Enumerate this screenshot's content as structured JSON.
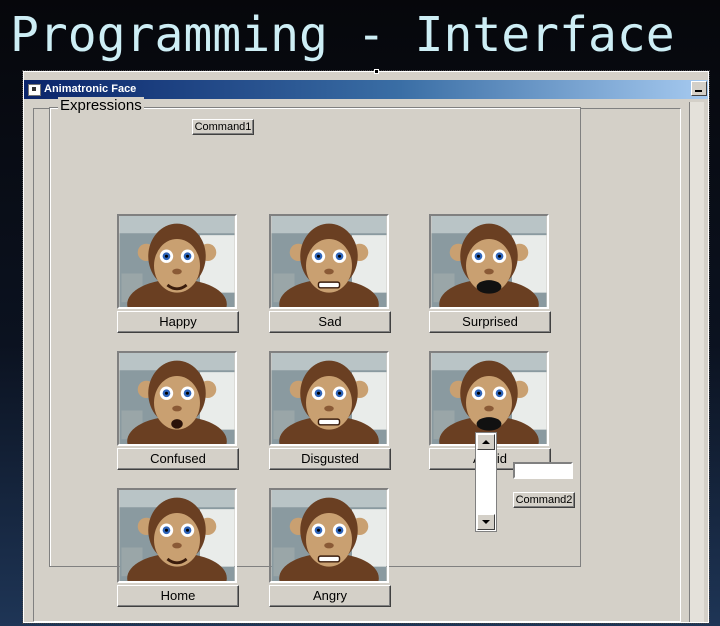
{
  "slide": {
    "title": "Programming - Interface"
  },
  "window": {
    "title": "Animatronic Face"
  },
  "frame": {
    "caption": "Expressions"
  },
  "buttons": {
    "command1": "Command1",
    "command2": "Command2"
  },
  "expressions": [
    {
      "label": "Happy",
      "mouth": "smile"
    },
    {
      "label": "Sad",
      "mouth": "teeth"
    },
    {
      "label": "Surprised",
      "mouth": "open"
    },
    {
      "label": "Confused",
      "mouth": "o"
    },
    {
      "label": "Disgusted",
      "mouth": "teeth"
    },
    {
      "label": "Afraid",
      "mouth": "open"
    },
    {
      "label": "Home",
      "mouth": "smile"
    },
    {
      "label": "Angry",
      "mouth": "teeth"
    }
  ],
  "textbox": {
    "value": ""
  },
  "colors": {
    "face": "#c9a071",
    "fur": "#6a3f22",
    "eye": "#2d63b8",
    "background": "#8a9aa0"
  }
}
